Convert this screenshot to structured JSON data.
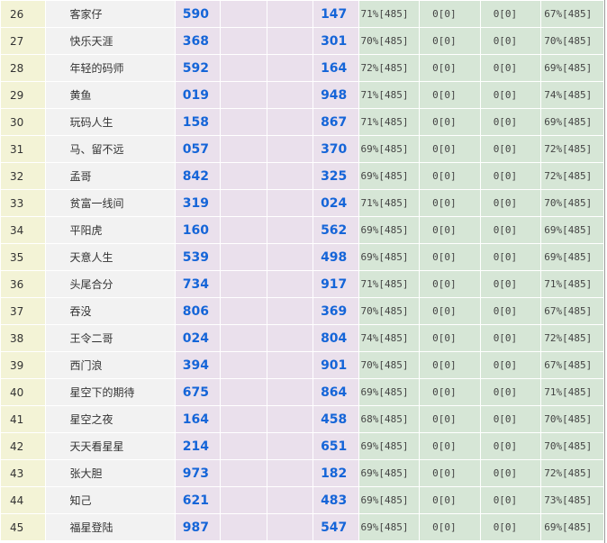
{
  "rows": [
    {
      "rank": "26",
      "name": "客家仔",
      "n1": "590",
      "n2": "147",
      "p1": "71%[485]",
      "z1": "0[0]",
      "z2": "0[0]",
      "p2": "67%[485]"
    },
    {
      "rank": "27",
      "name": "快乐天涯",
      "n1": "368",
      "n2": "301",
      "p1": "70%[485]",
      "z1": "0[0]",
      "z2": "0[0]",
      "p2": "70%[485]"
    },
    {
      "rank": "28",
      "name": "年轻的码师",
      "n1": "592",
      "n2": "164",
      "p1": "72%[485]",
      "z1": "0[0]",
      "z2": "0[0]",
      "p2": "69%[485]"
    },
    {
      "rank": "29",
      "name": "黄鱼",
      "n1": "019",
      "n2": "948",
      "p1": "71%[485]",
      "z1": "0[0]",
      "z2": "0[0]",
      "p2": "74%[485]"
    },
    {
      "rank": "30",
      "name": "玩码人生",
      "n1": "158",
      "n2": "867",
      "p1": "71%[485]",
      "z1": "0[0]",
      "z2": "0[0]",
      "p2": "69%[485]"
    },
    {
      "rank": "31",
      "name": "马、留不远",
      "n1": "057",
      "n2": "370",
      "p1": "69%[485]",
      "z1": "0[0]",
      "z2": "0[0]",
      "p2": "72%[485]"
    },
    {
      "rank": "32",
      "name": "孟哥",
      "n1": "842",
      "n2": "325",
      "p1": "69%[485]",
      "z1": "0[0]",
      "z2": "0[0]",
      "p2": "72%[485]"
    },
    {
      "rank": "33",
      "name": "贫富一线间",
      "n1": "319",
      "n2": "024",
      "p1": "71%[485]",
      "z1": "0[0]",
      "z2": "0[0]",
      "p2": "70%[485]"
    },
    {
      "rank": "34",
      "name": "平阳虎",
      "n1": "160",
      "n2": "562",
      "p1": "69%[485]",
      "z1": "0[0]",
      "z2": "0[0]",
      "p2": "69%[485]"
    },
    {
      "rank": "35",
      "name": "天意人生",
      "n1": "539",
      "n2": "498",
      "p1": "69%[485]",
      "z1": "0[0]",
      "z2": "0[0]",
      "p2": "69%[485]"
    },
    {
      "rank": "36",
      "name": "头尾合分",
      "n1": "734",
      "n2": "917",
      "p1": "71%[485]",
      "z1": "0[0]",
      "z2": "0[0]",
      "p2": "71%[485]"
    },
    {
      "rank": "37",
      "name": "吞没",
      "n1": "806",
      "n2": "369",
      "p1": "70%[485]",
      "z1": "0[0]",
      "z2": "0[0]",
      "p2": "67%[485]"
    },
    {
      "rank": "38",
      "name": "王令二哥",
      "n1": "024",
      "n2": "804",
      "p1": "74%[485]",
      "z1": "0[0]",
      "z2": "0[0]",
      "p2": "72%[485]"
    },
    {
      "rank": "39",
      "name": "西门浪",
      "n1": "394",
      "n2": "901",
      "p1": "70%[485]",
      "z1": "0[0]",
      "z2": "0[0]",
      "p2": "67%[485]"
    },
    {
      "rank": "40",
      "name": "星空下的期待",
      "n1": "675",
      "n2": "864",
      "p1": "69%[485]",
      "z1": "0[0]",
      "z2": "0[0]",
      "p2": "71%[485]"
    },
    {
      "rank": "41",
      "name": "星空之夜",
      "n1": "164",
      "n2": "458",
      "p1": "68%[485]",
      "z1": "0[0]",
      "z2": "0[0]",
      "p2": "70%[485]"
    },
    {
      "rank": "42",
      "name": "天天看星星",
      "n1": "214",
      "n2": "651",
      "p1": "69%[485]",
      "z1": "0[0]",
      "z2": "0[0]",
      "p2": "70%[485]"
    },
    {
      "rank": "43",
      "name": "张大胆",
      "n1": "973",
      "n2": "182",
      "p1": "69%[485]",
      "z1": "0[0]",
      "z2": "0[0]",
      "p2": "72%[485]"
    },
    {
      "rank": "44",
      "name": "知己",
      "n1": "621",
      "n2": "483",
      "p1": "69%[485]",
      "z1": "0[0]",
      "z2": "0[0]",
      "p2": "73%[485]"
    },
    {
      "rank": "45",
      "name": "福星登陆",
      "n1": "987",
      "n2": "547",
      "p1": "69%[485]",
      "z1": "0[0]",
      "z2": "0[0]",
      "p2": "69%[485]"
    }
  ]
}
